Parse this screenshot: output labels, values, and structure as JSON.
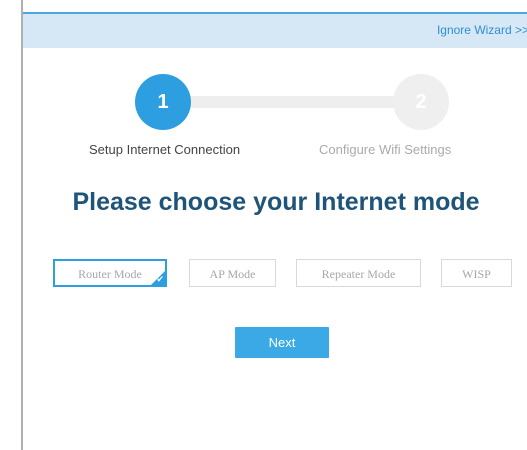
{
  "header": {
    "ignore_wizard": "Ignore Wizard >>"
  },
  "stepper": {
    "steps": [
      {
        "number": "1",
        "label": "Setup Internet Connection",
        "active": true
      },
      {
        "number": "2",
        "label": "Configure Wifi Settings",
        "active": false
      }
    ]
  },
  "main": {
    "heading": "Please choose your Internet mode",
    "modes": [
      {
        "label": "Router Mode",
        "selected": true
      },
      {
        "label": "AP Mode",
        "selected": false
      },
      {
        "label": "Repeater Mode",
        "selected": false
      },
      {
        "label": "WISP",
        "selected": false
      }
    ],
    "next_label": "Next"
  },
  "colors": {
    "accent": "#2d9fe0",
    "heading": "#1f5479",
    "header_bar": "#d6e7f5",
    "inactive_step": "#efefef",
    "inactive_text": "#aaaaaa"
  },
  "icons": {
    "selected_indicator": "checkmark-icon"
  }
}
